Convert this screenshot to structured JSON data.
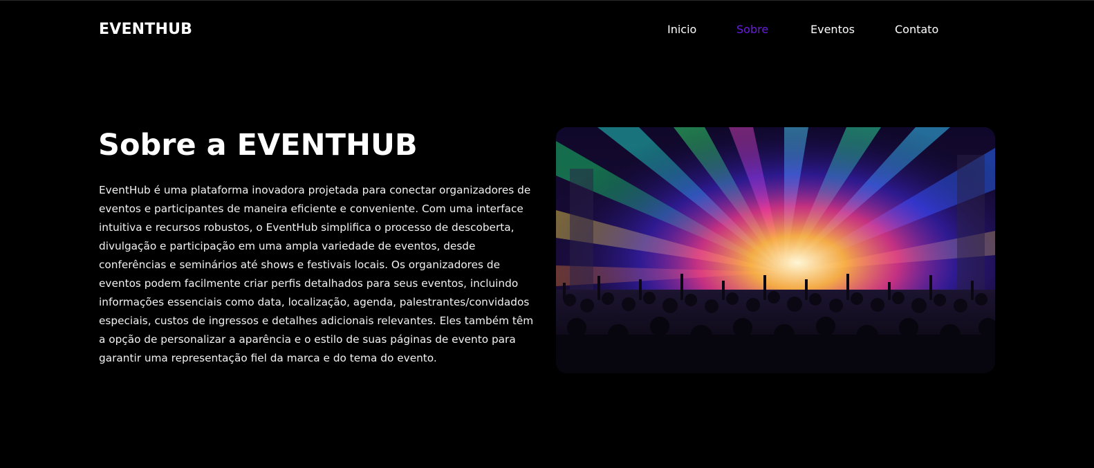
{
  "header": {
    "logo": "EVENTHUB",
    "nav": [
      {
        "label": "Inicio",
        "active": false
      },
      {
        "label": "Sobre",
        "active": true
      },
      {
        "label": "Eventos",
        "active": false
      },
      {
        "label": "Contato",
        "active": false
      }
    ]
  },
  "about": {
    "title": "Sobre a EVENTHUB",
    "paragraph": "EventHub é uma plataforma inovadora projetada para conectar organizadores de eventos e participantes de maneira eficiente e conveniente. Com uma interface intuitiva e recursos robustos, o EventHub simplifica o processo de descoberta, divulgação e participação em uma ampla variedade de eventos, desde conferências e seminários até shows e festivais locais. Os organizadores de eventos podem facilmente criar perfis detalhados para seus eventos, incluindo informações essenciais como data, localização, agenda, palestrantes/convidados especiais, custos de ingressos e detalhes adicionais relevantes. Eles também têm a opção de personalizar a aparência e o estilo de suas páginas de evento para garantir uma representação fiel da marca e do tema do evento.",
    "image_icon": "concert-crowd-lights-image"
  },
  "colors": {
    "background": "#000000",
    "text": "#ffffff",
    "accent": "#6a1be6"
  }
}
